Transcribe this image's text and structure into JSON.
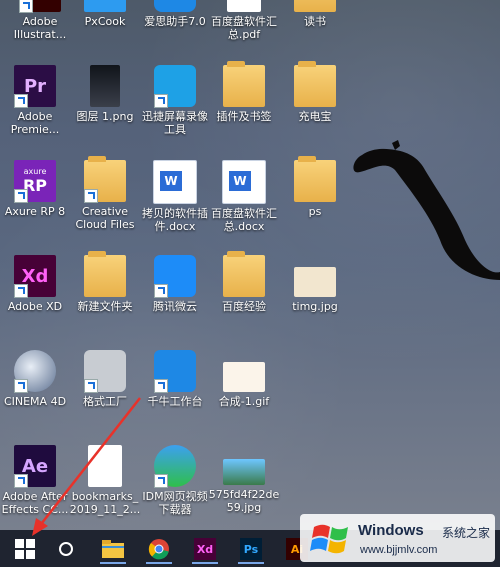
{
  "desktop": {
    "icons": [
      {
        "label": "Adobe\nIllustrat...",
        "icon": "adobe-illustrator-icon"
      },
      {
        "label": "PxCook",
        "icon": "pxcook-icon"
      },
      {
        "label": "爱思助手7.0",
        "icon": "i4-assistant-icon"
      },
      {
        "label": "百度盘软件汇\n总.pdf",
        "icon": "pdf-icon"
      },
      {
        "label": "读书",
        "icon": "folder-icon"
      },
      {
        "label": "Adobe\nPremie...",
        "icon": "adobe-premiere-icon",
        "badge": "Pr"
      },
      {
        "label": "图层 1.png",
        "icon": "png-image-icon"
      },
      {
        "label": "迅捷屏幕录像\n工具",
        "icon": "screen-recorder-icon"
      },
      {
        "label": "插件及书签",
        "icon": "folder-icon"
      },
      {
        "label": "充电宝",
        "icon": "folder-icon"
      },
      {
        "label": "Axure RP 8",
        "icon": "axure-icon",
        "badge": "RP",
        "badge_sub": "axure"
      },
      {
        "label": "Creative\nCloud Files",
        "icon": "creative-cloud-folder-icon"
      },
      {
        "label": "拷贝的软件插\n件.docx",
        "icon": "docx-icon",
        "badge": "W"
      },
      {
        "label": "百度盘软件汇\n总.docx",
        "icon": "docx-icon",
        "badge": "W"
      },
      {
        "label": "ps",
        "icon": "folder-icon"
      },
      {
        "label": "Adobe XD",
        "icon": "adobe-xd-icon",
        "badge": "Xd"
      },
      {
        "label": "新建文件夹",
        "icon": "folder-icon"
      },
      {
        "label": "腾讯微云",
        "icon": "weiyun-cloud-icon"
      },
      {
        "label": "百度经验",
        "icon": "folder-icon"
      },
      {
        "label": "timg.jpg",
        "icon": "jpg-image-icon"
      },
      {
        "label": "CINEMA 4D",
        "icon": "cinema4d-icon"
      },
      {
        "label": "格式工厂",
        "icon": "format-factory-icon"
      },
      {
        "label": "千牛工作台",
        "icon": "qianniu-icon"
      },
      {
        "label": "合成-1.gif",
        "icon": "gif-image-icon"
      },
      {
        "label": "Adobe After\nEffects CC...",
        "icon": "adobe-aftereffects-icon",
        "badge": "Ae"
      },
      {
        "label": "bookmarks_\n2019_11_2...",
        "icon": "html-bookmarks-icon"
      },
      {
        "label": "IDM网页视频\n下载器",
        "icon": "idm-icon"
      },
      {
        "label": "575fd4f22de\n59.jpg",
        "icon": "jpg-image-icon"
      }
    ]
  },
  "taskbar": {
    "items": [
      {
        "name": "start-button",
        "icon": "windows-logo-icon"
      },
      {
        "name": "cortana-button",
        "icon": "circle-icon"
      },
      {
        "name": "file-explorer-button",
        "icon": "folder-icon"
      },
      {
        "name": "chrome-button",
        "icon": "chrome-icon"
      },
      {
        "name": "adobe-xd-taskbar",
        "icon": "adobe-xd-icon",
        "badge": "Xd"
      },
      {
        "name": "photoshop-taskbar",
        "icon": "photoshop-icon",
        "badge": "Ps"
      },
      {
        "name": "illustrator-taskbar",
        "icon": "adobe-illustrator-icon",
        "badge": "Ai"
      }
    ]
  },
  "watermark": {
    "brand": "Windows",
    "brand_cn": "系统之家",
    "url": "www.bjjmlv.com"
  },
  "colors": {
    "premiere": "#2b0d45",
    "premiere_text": "#e3b0ff",
    "axure": "#7a24b8",
    "xd": "#470137",
    "xd_text": "#ff61f6",
    "aftereffects": "#1f0b3e",
    "aftereffects_text": "#d5a6ff",
    "photoshop": "#001e36",
    "photoshop_text": "#31a8ff",
    "taskbar": "#1f2430",
    "arrow": "#e8322a"
  }
}
